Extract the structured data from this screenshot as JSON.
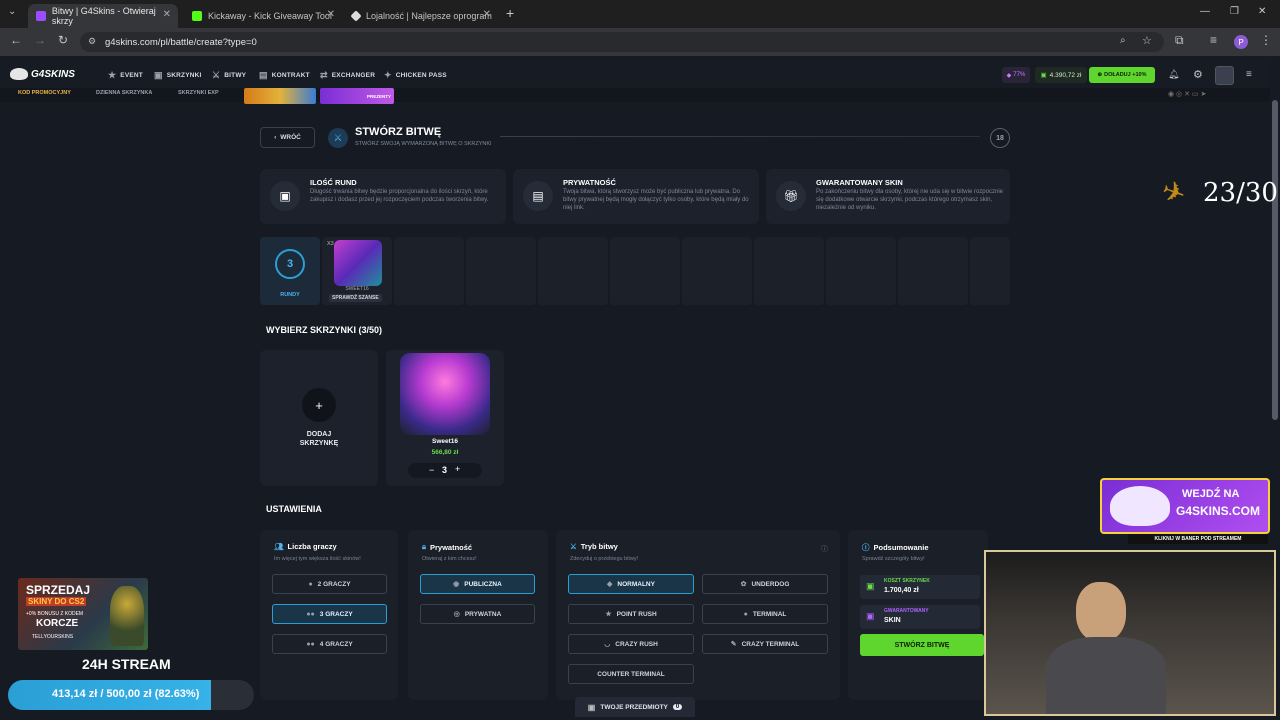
{
  "browser": {
    "tabs": [
      {
        "label": "Bitwy | G4Skins - Otwieraj skrzy",
        "color": "#9b4dff",
        "active": true
      },
      {
        "label": "Kickaway - Kick Giveaway Tool",
        "color": "#53fc18",
        "active": false
      },
      {
        "label": "Lojalność | Najlepsze oprogram",
        "color": "#dddddd",
        "active": false
      }
    ],
    "new_tab": "+",
    "url": "g4skins.com/pl/battle/create?type=0",
    "profile": "P"
  },
  "site": {
    "logo": "G4SKINS",
    "nav": [
      "EVENT",
      "SKRZYNKI",
      "BITWY",
      "KONTRAKT",
      "EXCHANGER",
      "CHICKEN PASS"
    ],
    "level": "77%",
    "balance": "4.390,72 zł",
    "topup": "DOŁADUJ +10%",
    "subnav": [
      "KOD PROMOCYJNY",
      "DZIENNA SKRZYNKA",
      "SKRZYNKI EXP"
    ],
    "banner_label": "PREZENTY"
  },
  "page": {
    "back": "WRÓĆ",
    "title": "STWÓRZ BITWĘ",
    "subtitle": "STWÓRZ SWOJĄ WYMARZONĄ BITWĘ O SKRZYNKI",
    "age_badge": "18",
    "info": [
      {
        "title": "ILOŚĆ RUND",
        "text": "Długość trwania bitwy będzie proporcjonalna do ilości skrzyń, które zakupisz i dodasz przed jej rozpoczęciem podczas tworzenia bitwy."
      },
      {
        "title": "PRYWATNOŚĆ",
        "text": "Twoja bitwa, którą stworzysz może być publiczna lub prywatna. Do bitwy prywatnej będą mogły dołączyć tylko osoby, które będą miały do niej link."
      },
      {
        "title": "GWARANTOWANY SKIN",
        "text": "Po zakończeniu bitwy dla osoby, której nie uda się w bitwie rozpocznie się dodatkowe otwarcie skrzynki, podczas którego otrzymasz skin, niezależnie od wyniku."
      }
    ],
    "rounds": {
      "count": "3",
      "label": "RUNDY"
    },
    "first_case": {
      "multiplier": "X3",
      "name": "SWEET16",
      "check": "SPRAWDŹ SZANSE"
    },
    "cases_header": "WYBIERZ SKRZYNKI (3/50)",
    "add_case": "DODAJ SKRZYNKĘ",
    "case": {
      "name": "Sweet16",
      "price": "566,80 zł",
      "qty": "3",
      "minus": "−",
      "plus": "+"
    },
    "settings_header": "USTAWIENIA",
    "players": {
      "title": "Liczba graczy",
      "hint": "Im więcej tym większa ilość skinów!",
      "options": [
        "2 GRACZY",
        "3 GRACZY",
        "4 GRACZY"
      ],
      "selected": 1
    },
    "privacy": {
      "title": "Prywatność",
      "hint": "Otwieraj z kim chcesz!",
      "options": [
        "PUBLICZNA",
        "PRYWATNA"
      ],
      "selected": 0
    },
    "mode": {
      "title": "Tryb bitwy",
      "hint": "Zdecyduj o przebiegu bitwy!",
      "options": [
        "NORMALNY",
        "UNDERDOG",
        "POINT RUSH",
        "TERMINAL",
        "CRAZY RUSH",
        "CRAZY TERMINAL",
        "COUNTER TERMINAL"
      ],
      "selected": 0
    },
    "summary": {
      "title": "Podsumowanie",
      "hint": "Sprawdź szczegóły bitwy!",
      "cost_label": "KOSZT SKRZYNEK",
      "cost": "1.700,40 zł",
      "guar_label": "GWARANTOWANY",
      "guar": "SKIN",
      "create": "STWÓRZ BITWĘ"
    },
    "items_bar": {
      "label": "TWOJE PRZEDMIOTY",
      "count": "0"
    }
  },
  "overlay": {
    "counter": "23/30",
    "promo_top": "SPRZEDAJ",
    "promo_mid": "SKINY DO CS2",
    "promo_bonus": "+0% BONUSU Z KODEM",
    "promo_code": "KORCZE",
    "promo_brand": "TELLYOURSKINS",
    "stream": "24H STREAM",
    "goal": "413,14 zł / 500,00 zł (82.63%)",
    "goal_progress": 0.8263,
    "ad_line1": "WEJDŹ NA",
    "ad_line2": "G4SKINS.COM",
    "ad_sub": "KLIKNIJ W BANER POD STREAMEM"
  }
}
